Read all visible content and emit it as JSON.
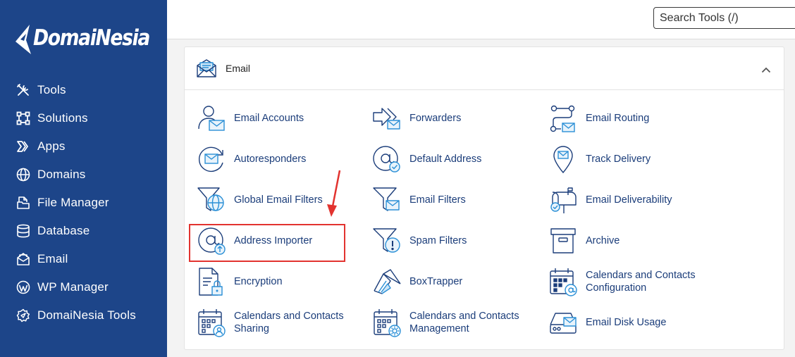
{
  "brand": {
    "name": "DomaiNesia"
  },
  "sidebar": {
    "items": [
      {
        "label": "Tools",
        "icon": "tools-icon"
      },
      {
        "label": "Solutions",
        "icon": "solutions-icon"
      },
      {
        "label": "Apps",
        "icon": "apps-icon"
      },
      {
        "label": "Domains",
        "icon": "globe-icon"
      },
      {
        "label": "File Manager",
        "icon": "file-manager-icon"
      },
      {
        "label": "Database",
        "icon": "database-icon"
      },
      {
        "label": "Email",
        "icon": "email-icon"
      },
      {
        "label": "WP Manager",
        "icon": "wordpress-icon"
      },
      {
        "label": "DomaiNesia Tools",
        "icon": "domainesia-tools-icon"
      }
    ]
  },
  "search": {
    "placeholder": "Search Tools (/)"
  },
  "panel": {
    "title": "Email",
    "tools": [
      {
        "label": "Email Accounts",
        "icon": "email-accounts-icon"
      },
      {
        "label": "Forwarders",
        "icon": "forwarders-icon"
      },
      {
        "label": "Email Routing",
        "icon": "email-routing-icon"
      },
      {
        "label": "Autoresponders",
        "icon": "autoresponders-icon"
      },
      {
        "label": "Default Address",
        "icon": "default-address-icon"
      },
      {
        "label": "Track Delivery",
        "icon": "track-delivery-icon"
      },
      {
        "label": "Global Email Filters",
        "icon": "global-email-filters-icon"
      },
      {
        "label": "Email Filters",
        "icon": "email-filters-icon"
      },
      {
        "label": "Email Deliverability",
        "icon": "email-deliverability-icon"
      },
      {
        "label": "Address Importer",
        "icon": "address-importer-icon"
      },
      {
        "label": "Spam Filters",
        "icon": "spam-filters-icon"
      },
      {
        "label": "Archive",
        "icon": "archive-icon"
      },
      {
        "label": "Encryption",
        "icon": "encryption-icon"
      },
      {
        "label": "BoxTrapper",
        "icon": "boxtrapper-icon"
      },
      {
        "label_1": "Calendars and Contacts",
        "label_2": "Configuration",
        "icon": "calendars-config-icon"
      },
      {
        "label_1": "Calendars and Contacts",
        "label_2": "Sharing",
        "icon": "calendars-sharing-icon"
      },
      {
        "label_1": "Calendars and Contacts",
        "label_2": "Management",
        "icon": "calendars-management-icon"
      },
      {
        "label": "Email Disk Usage",
        "icon": "email-disk-usage-icon"
      }
    ]
  },
  "colors": {
    "sidebar": "#1d4589",
    "link": "#1b3d7a",
    "icon": "#1b3d7a",
    "accent": "#2a8fd6",
    "highlight": "#e2332f"
  }
}
